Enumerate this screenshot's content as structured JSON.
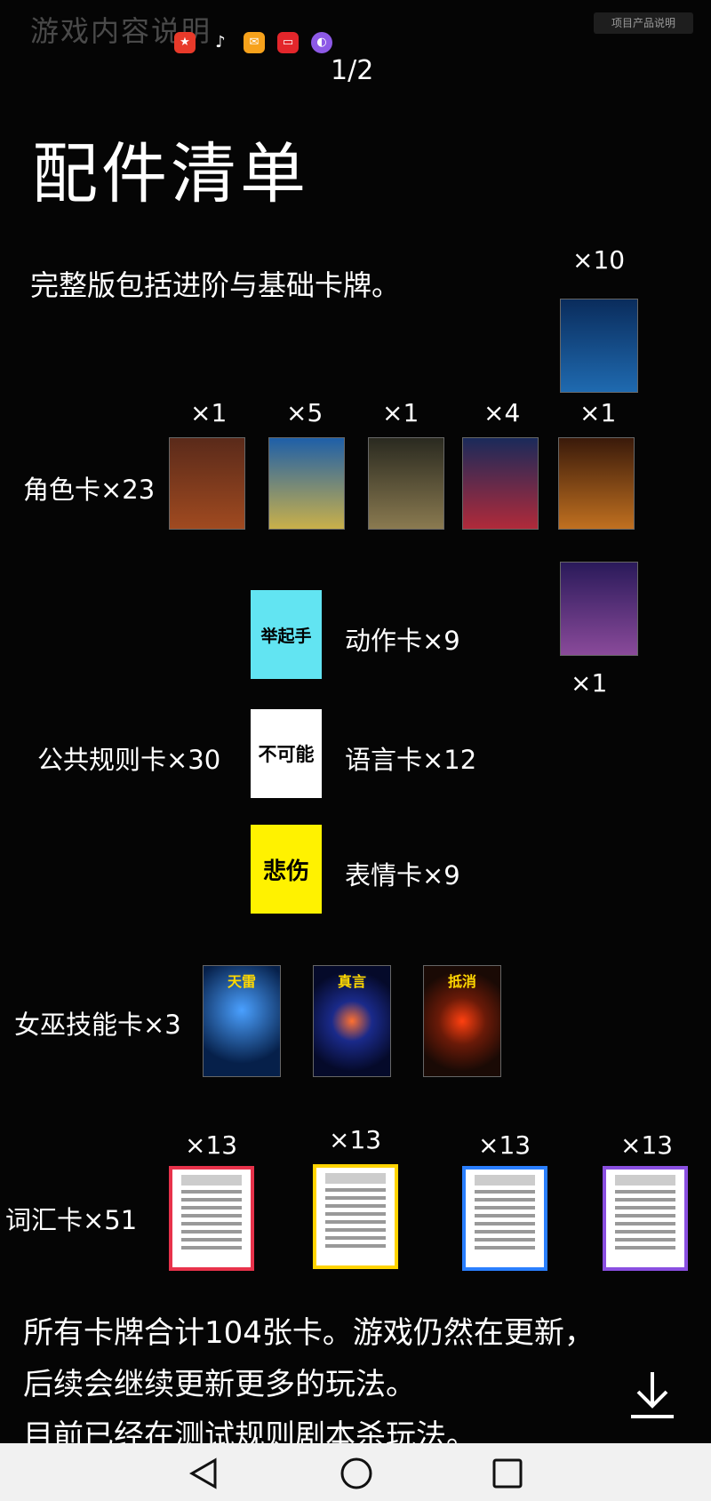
{
  "header": {
    "ghost_title": "游戏内容说明",
    "tag_button": "项目产品说明",
    "pager": "1/2"
  },
  "app_icons": [
    "red-app-icon",
    "tiktok-icon",
    "mail-icon",
    "book-icon",
    "purple-app-icon"
  ],
  "title": "配件清单",
  "intro": "完整版包括进阶与基础卡牌。",
  "role_cards": {
    "label": "角色卡×23",
    "counts": [
      "×1",
      "×5",
      "×1",
      "×4",
      "×1"
    ],
    "top_extra": "×10",
    "bottom_extra": "×1"
  },
  "rule_cards": {
    "label": "公共规则卡×30",
    "items": [
      {
        "card_text": "举起手",
        "label": "动作卡×9",
        "color": "#62e4f2"
      },
      {
        "card_text": "不可能",
        "label": "语言卡×12",
        "color": "#ffffff"
      },
      {
        "card_text": "悲伤",
        "label": "表情卡×9",
        "color": "#fff200"
      }
    ]
  },
  "witch_cards": {
    "label": "女巫技能卡×3",
    "names": [
      "天雷",
      "真言",
      "抵消"
    ]
  },
  "vocab_cards": {
    "label": "词汇卡×51",
    "counts": [
      "×13",
      "×13",
      "×13",
      "×13"
    ],
    "colors": [
      "#e8324b",
      "#ffd400",
      "#2a7fff",
      "#8a4fe0"
    ]
  },
  "footer": {
    "lines": [
      "所有卡牌合计104张卡。游戏仍然在更新，",
      "后续会继续更新更多的玩法。",
      "目前已经在测试规则剧本杀玩法。"
    ]
  },
  "nav": [
    "back-icon",
    "home-icon",
    "recents-icon"
  ]
}
